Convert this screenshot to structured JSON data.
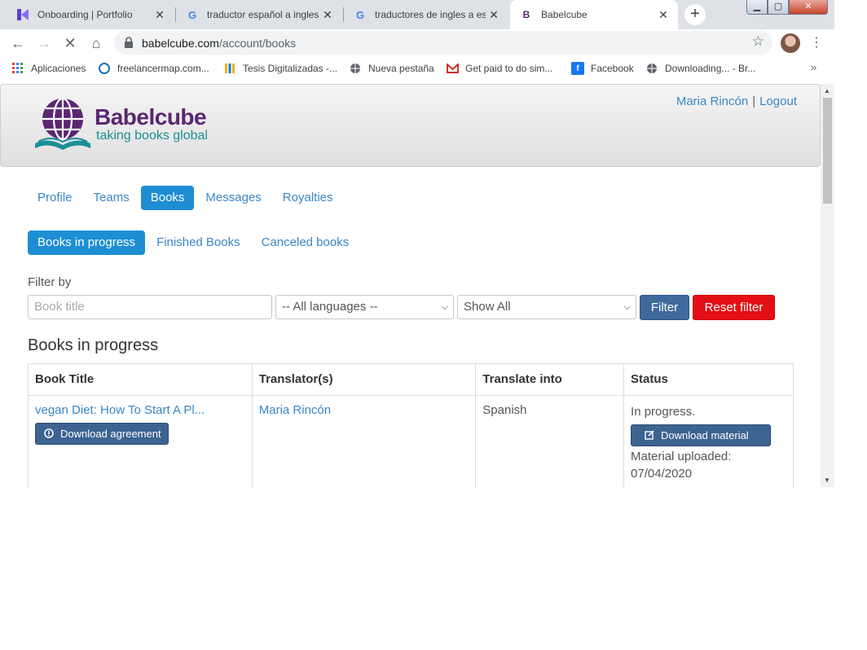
{
  "browser": {
    "tabs": [
      {
        "title": "Onboarding | Portfolio",
        "icon": "k-logo-icon",
        "active": false
      },
      {
        "title": "traductor español a ingles",
        "icon": "google-icon",
        "active": false
      },
      {
        "title": "traductores de ingles a esp",
        "icon": "google-icon",
        "active": false
      },
      {
        "title": "Babelcube",
        "icon": "babelcube-favicon-icon",
        "active": true
      }
    ],
    "new_tab": "+",
    "url_domain": "babelcube.com",
    "url_path": "/account/books",
    "bookmarks": [
      {
        "label": "Aplicaciones",
        "icon": "apps-grid-icon"
      },
      {
        "label": "freelancermap.com...",
        "icon": "freelancermap-icon"
      },
      {
        "label": "Tesis Digitalizadas -...",
        "icon": "tesis-icon"
      },
      {
        "label": "Nueva pestaña",
        "icon": "globe-icon"
      },
      {
        "label": "Get paid to do sim...",
        "icon": "gmail-icon"
      },
      {
        "label": "Facebook",
        "icon": "facebook-icon"
      },
      {
        "label": "Downloading... - Br...",
        "icon": "globe-icon"
      }
    ],
    "bookmarks_more": "»"
  },
  "header": {
    "brand_name": "Babelcube",
    "tagline": "taking books global",
    "user_name": "Maria Rincón",
    "separator": "|",
    "logout": "Logout"
  },
  "main_nav": [
    "Profile",
    "Teams",
    "Books",
    "Messages",
    "Royalties"
  ],
  "main_nav_active": "Books",
  "sub_nav": [
    "Books in progress",
    "Finished Books",
    "Canceled books"
  ],
  "sub_nav_active": "Books in progress",
  "filter": {
    "label": "Filter by",
    "title_placeholder": "Book title",
    "language_selected": "-- All languages --",
    "show_selected": "Show All",
    "filter_button": "Filter",
    "reset_button": "Reset filter"
  },
  "section_title": "Books in progress",
  "table": {
    "columns": [
      "Book Title",
      "Translator(s)",
      "Translate into",
      "Status"
    ],
    "rows": [
      {
        "title": "vegan Diet: How To Start A Pl...",
        "agreement_button": "Download agreement",
        "translator": "Maria Rincón",
        "language": "Spanish",
        "status": "In progress.",
        "material_button": "Download material",
        "material_note": "Material uploaded:",
        "material_date": "07/04/2020"
      }
    ]
  },
  "colors": {
    "brand_purple": "#5a2771",
    "brand_teal": "#1b8e97",
    "link_blue": "#3a87c7",
    "active_pill": "#1e8ed3",
    "filter_button": "#3f6a9c",
    "reset_button": "#e30f14"
  }
}
